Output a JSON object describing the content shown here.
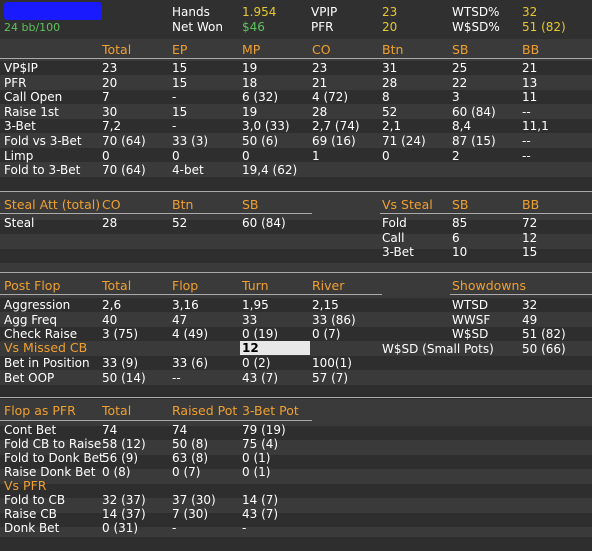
{
  "header": {
    "hands_label": "Hands",
    "hands_value": "1.954",
    "vpip_label": "VPIP",
    "vpip_value": "23",
    "wtsd_label": "WTSD%",
    "wtsd_value": "32",
    "winrate": "24 bb/100",
    "netwon_label": "Net Won",
    "netwon_value": "$46",
    "pfr_label": "PFR",
    "pfr_value": "20",
    "wssd_label": "W$SD%",
    "wssd_value": "51 (82)"
  },
  "preflop": {
    "headers": [
      "Total",
      "EP",
      "MP",
      "CO",
      "Btn",
      "SB",
      "BB"
    ],
    "rows": [
      {
        "label": "VP$IP",
        "cells": [
          "23",
          "15",
          "19",
          "23",
          "31",
          "25",
          "21"
        ]
      },
      {
        "label": "PFR",
        "cells": [
          "20",
          "15",
          "18",
          "21",
          "28",
          "22",
          "13"
        ]
      },
      {
        "label": "Call Open",
        "cells": [
          "7",
          "-",
          "6 (32)",
          "4 (72)",
          "8",
          "3",
          "11"
        ]
      },
      {
        "label": "Raise 1st",
        "cells": [
          "30",
          "15",
          "19",
          "28",
          "52",
          "60 (84)",
          "--"
        ]
      },
      {
        "label": "3-Bet",
        "cells": [
          "7,2",
          "-",
          "3,0 (33)",
          "2,7 (74)",
          "2,1",
          "8,4",
          "11,1"
        ]
      },
      {
        "label": "Fold vs 3-Bet",
        "cells": [
          "70 (64)",
          "33 (3)",
          "50 (6)",
          "69 (16)",
          "71 (24)",
          "87 (15)",
          "--"
        ]
      },
      {
        "label": "Limp",
        "cells": [
          "0",
          "0",
          "0",
          "1",
          "0",
          "2",
          "--"
        ]
      },
      {
        "label": "Fold to 3-Bet",
        "cells": [
          "70 (64)",
          "4-bet",
          "19,4 (62)",
          "",
          "",
          "",
          ""
        ]
      }
    ]
  },
  "steal": {
    "title": "Steal Att (total)",
    "headers": [
      "CO",
      "Btn",
      "SB"
    ],
    "row_label": "Steal",
    "row_cells": [
      "28",
      "52",
      "60 (84)"
    ],
    "vs_title": "Vs Steal",
    "vs_headers": [
      "SB",
      "BB"
    ],
    "vs_rows": [
      {
        "label": "Fold",
        "cells": [
          "85",
          "72"
        ]
      },
      {
        "label": "Call",
        "cells": [
          "6",
          "12"
        ]
      },
      {
        "label": "3-Bet",
        "cells": [
          "10",
          "15"
        ]
      }
    ]
  },
  "postflop": {
    "title": "Post Flop",
    "headers": [
      "Total",
      "Flop",
      "Turn",
      "River"
    ],
    "rows": [
      {
        "label": "Aggression",
        "cells": [
          "2,6",
          "3,16",
          "1,95",
          "2,15"
        ]
      },
      {
        "label": "Agg Freq",
        "cells": [
          "40",
          "47",
          "33",
          "33 (86)"
        ]
      },
      {
        "label": "Check Raise",
        "cells": [
          "3 (75)",
          "4 (49)",
          "0 (19)",
          "0 (7)"
        ]
      }
    ],
    "missed_title": "Vs Missed CB",
    "missed_value": "12",
    "rows2": [
      {
        "label": "Bet in Position",
        "cells": [
          "33 (9)",
          "33 (6)",
          "0 (2)",
          "100(1)"
        ]
      },
      {
        "label": "Bet OOP",
        "cells": [
          "50 (14)",
          "--",
          "43 (7)",
          "57 (7)"
        ]
      }
    ],
    "showdowns_title": "Showdowns",
    "showdowns": [
      {
        "label": "WTSD",
        "value": "32"
      },
      {
        "label": "WWSF",
        "value": "49"
      },
      {
        "label": "W$SD",
        "value": "51 (82)"
      },
      {
        "label": "W$SD (Small Pots)",
        "value": "50 (66)"
      }
    ]
  },
  "pfr_section": {
    "title": "Flop as PFR",
    "headers": [
      "Total",
      "Raised Pot",
      "3-Bet Pot"
    ],
    "rows": [
      {
        "label": "Cont Bet",
        "cells": [
          "74",
          "74",
          "79 (19)"
        ]
      },
      {
        "label": "Fold CB to Raise",
        "cells": [
          "58 (12)",
          "50 (8)",
          "75 (4)"
        ]
      },
      {
        "label": "Fold to Donk Bet",
        "cells": [
          "56 (9)",
          "63 (8)",
          "0 (1)"
        ]
      },
      {
        "label": "Raise Donk Bet",
        "cells": [
          "0 (8)",
          "0 (7)",
          "0 (1)"
        ]
      }
    ],
    "vs_title": "Vs PFR",
    "vs_rows": [
      {
        "label": "Fold to CB",
        "cells": [
          "32 (37)",
          "37 (30)",
          "14 (7)"
        ]
      },
      {
        "label": "Raise CB",
        "cells": [
          "14 (37)",
          "7 (30)",
          "43 (7)"
        ]
      },
      {
        "label": "Donk Bet",
        "cells": [
          "0 (31)",
          "-",
          "-"
        ]
      }
    ]
  },
  "colors": {
    "accent": "#f0a030",
    "positive": "#5ec25e",
    "value": "#e6c830",
    "bg": "#3a3a3a"
  }
}
